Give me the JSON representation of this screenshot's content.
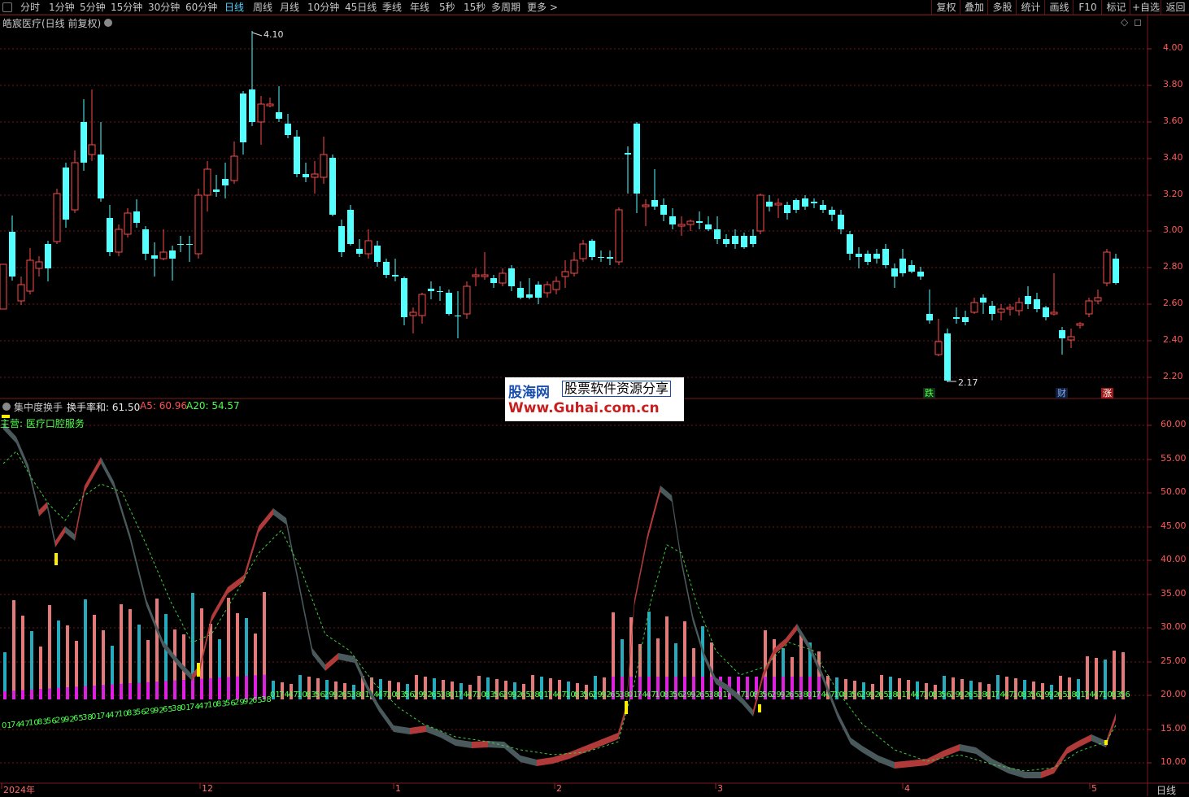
{
  "toolbar": {
    "tabs": [
      "分时",
      "1分钟",
      "5分钟",
      "15分钟",
      "30分钟",
      "60分钟",
      "日线",
      "周线",
      "月线",
      "10分钟",
      "45日线",
      "季线",
      "年线",
      "5秒",
      "15秒",
      "多周期",
      "更多 >"
    ],
    "active_tab": "日线",
    "right_buttons": [
      "复权",
      "叠加",
      "多股",
      "统计",
      "画线",
      "F10",
      "标记",
      "+自选",
      "返回"
    ]
  },
  "main_chart": {
    "title": "皓宸医疗(日线 前复权)",
    "high_label": "4.10",
    "low_label": "2.17",
    "y_ticks": [
      "4.00",
      "3.80",
      "3.60",
      "3.40",
      "3.20",
      "3.00",
      "2.80",
      "2.60",
      "2.40",
      "2.20"
    ],
    "markers": [
      "跌",
      "财",
      "涨"
    ]
  },
  "indicator": {
    "name": "集中度换手",
    "line1_label": "换手率和: 61.50",
    "line2_label": "A5: 60.96",
    "line3_label": "A20: 54.57",
    "sub_label": "主营: 医疗口腔服务",
    "y_ticks": [
      "60.00",
      "55.00",
      "50.00",
      "45.00",
      "40.00",
      "35.00",
      "30.00",
      "25.00",
      "20.00",
      "15.00",
      "10.00"
    ]
  },
  "x_axis": {
    "labels": [
      "2024年",
      "12",
      "1",
      "2",
      "3",
      "4",
      "5"
    ],
    "period": "日线"
  },
  "watermark": {
    "brand": "股海网",
    "slogan": "股票软件资源分享",
    "url": "Www.Guhai.com.cn"
  },
  "colors": {
    "up": "#ff4a4a",
    "down": "#54ffff",
    "grid": "#6b1a1a",
    "active": "#4fd0ff"
  }
}
